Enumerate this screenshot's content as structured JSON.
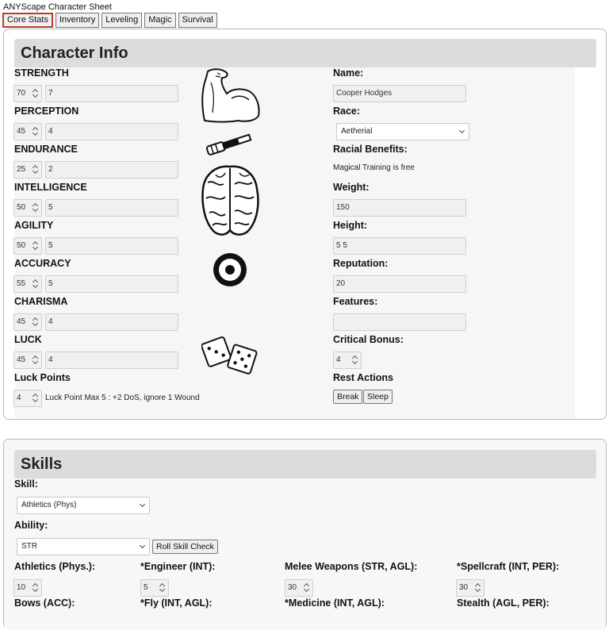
{
  "app_title": "ANYScape Character Sheet",
  "tabs": [
    "Core Stats",
    "Inventory",
    "Leveling",
    "Magic",
    "Survival"
  ],
  "character_info": {
    "header": "Character Info",
    "stats": [
      {
        "label": "STRENGTH",
        "score": "70",
        "mod": "7"
      },
      {
        "label": "PERCEPTION",
        "score": "45",
        "mod": "4"
      },
      {
        "label": "ENDURANCE",
        "score": "25",
        "mod": "2"
      },
      {
        "label": "INTELLIGENCE",
        "score": "50",
        "mod": "5"
      },
      {
        "label": "AGILITY",
        "score": "50",
        "mod": "5"
      },
      {
        "label": "ACCURACY",
        "score": "55",
        "mod": "5"
      },
      {
        "label": "CHARISMA",
        "score": "45",
        "mod": "4"
      },
      {
        "label": "LUCK",
        "score": "45",
        "mod": "4"
      }
    ],
    "luck_points": {
      "label": "Luck Points",
      "value": "4",
      "note": "Luck Point Max 5 : +2 DoS, ignore 1 Wound"
    },
    "name": {
      "label": "Name:",
      "value": "Cooper Hodges"
    },
    "race": {
      "label": "Race:",
      "value": "Aetherial"
    },
    "racial_benefits": {
      "label": "Racial Benefits:",
      "value": "Magical Training is free"
    },
    "weight": {
      "label": "Weight:",
      "value": "150"
    },
    "height": {
      "label": "Height:",
      "value": "5 5"
    },
    "reputation": {
      "label": "Reputation:",
      "value": "20"
    },
    "features": {
      "label": "Features:",
      "value": ""
    },
    "critical_bonus": {
      "label": "Critical Bonus:",
      "value": "4"
    },
    "rest_actions": {
      "label": "Rest Actions",
      "break_label": "Break",
      "sleep_label": "Sleep"
    },
    "icons": [
      "flexed-arm-icon",
      "spyglass-icon",
      "brain-icon",
      "target-icon",
      "dice-icon"
    ]
  },
  "skills": {
    "header": "Skills",
    "skill_label": "Skill:",
    "skill_value": "Athletics (Phys)",
    "ability_label": "Ability:",
    "ability_value": "STR",
    "roll_button": "Roll Skill Check",
    "row1": [
      {
        "label": "Athletics (Phys.):",
        "value": "10"
      },
      {
        "label": "*Engineer (INT):",
        "value": "5"
      },
      {
        "label": "Melee Weapons (STR, AGL):",
        "value": "30"
      },
      {
        "label": "*Spellcraft (INT, PER):",
        "value": "30"
      }
    ],
    "row2": [
      {
        "label": "Bows (ACC):"
      },
      {
        "label": "*Fly (INT, AGL):"
      },
      {
        "label": "*Medicine (INT, AGL):"
      },
      {
        "label": "Stealth (AGL, PER):"
      }
    ]
  },
  "colors": {
    "active_tab_border": "#c0392b",
    "header_bg": "#dcdcdc"
  }
}
